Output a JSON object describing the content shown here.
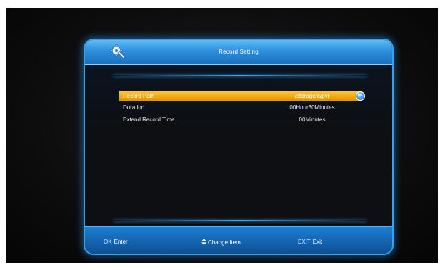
{
  "window": {
    "title": "Record Setting"
  },
  "menu": {
    "rows": [
      {
        "label": "Record Path",
        "value": "/storage/c/pvr",
        "selected": true
      },
      {
        "label": "Duration",
        "value": "00Hour30Minutes",
        "selected": false
      },
      {
        "label": "Extend Record Time",
        "value": "00Minutes",
        "selected": false
      }
    ],
    "ok_badge": "OK"
  },
  "footer": {
    "ok_key": "OK",
    "ok_action": "Enter",
    "change_action": "Change Item",
    "exit_key": "EXIT",
    "exit_action": "Exit"
  },
  "colors": {
    "accent_blue": "#2d8fdc",
    "highlight_orange": "#f0a810",
    "background": "#0d0f12"
  },
  "icons": {
    "header": "gear-wrench-icon",
    "ok": "ok-circle-icon",
    "navigate": "up-down-arrows-icon"
  }
}
